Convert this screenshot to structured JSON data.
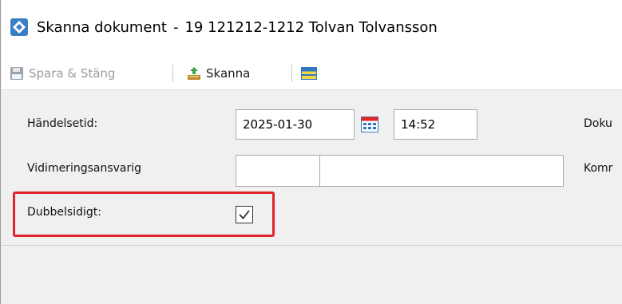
{
  "window": {
    "title": "Skanna dokument",
    "title_separator": "-",
    "patient": "19 121212-1212 Tolvan Tolvansson",
    "icon": "diamond-app-icon"
  },
  "toolbar": {
    "save_close_label": "Spara & Stäng",
    "scan_label": "Skanna",
    "icons": [
      "floppy-disk-icon",
      "scanner-icon",
      "panel-toggle-icon"
    ]
  },
  "form": {
    "event_time_label": "Händelsetid:",
    "event_date_value": "2025-01-30",
    "event_time_value": "14:52",
    "certifier_label": "Vidimeringsansvarig",
    "certifier_code_value": "",
    "certifier_name_value": "",
    "double_sided_label": "Dubbelsidigt:",
    "double_sided_checked": true,
    "doc_label_truncated": "Doku",
    "comment_label_truncated": "Komr"
  },
  "colors": {
    "highlight": "#e0242b",
    "background": "#f0f0f0",
    "accent_blue": "#2f78c4"
  }
}
